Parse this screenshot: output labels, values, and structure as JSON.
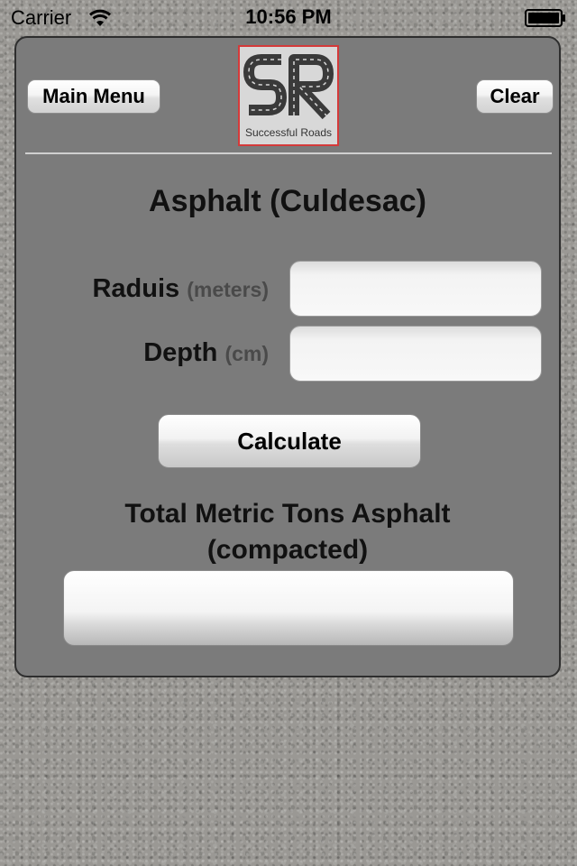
{
  "status_bar": {
    "carrier": "Carrier",
    "wifi_icon": "wifi-icon",
    "time": "10:56 PM",
    "battery_icon": "battery-icon"
  },
  "header": {
    "main_menu_label": "Main Menu",
    "clear_label": "Clear",
    "logo_text": "SR",
    "logo_caption": "Successful Roads"
  },
  "form": {
    "title": "Asphalt (Culdesac)",
    "radius_label": "Raduis",
    "radius_unit": "(meters)",
    "radius_value": "",
    "depth_label": "Depth",
    "depth_unit": "(cm)",
    "depth_value": "",
    "calculate_label": "Calculate"
  },
  "result": {
    "label_line1": "Total Metric Tons Asphalt",
    "label_line2": "(compacted)",
    "value": ""
  },
  "colors": {
    "panel_bg": "#7b7b7b",
    "logo_border": "#d43a3a"
  }
}
